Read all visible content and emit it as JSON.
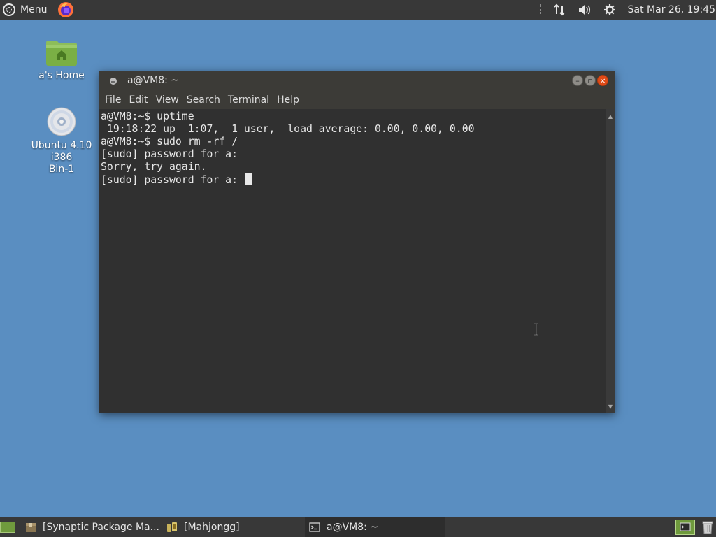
{
  "top_panel": {
    "menu_label": "Menu",
    "clock": "Sat Mar 26, 19:45"
  },
  "desktop": {
    "icons": [
      {
        "label": "a's Home"
      },
      {
        "label_line1": "Ubuntu 4.10 i386",
        "label_line2": "Bin-1"
      }
    ]
  },
  "terminal": {
    "title": "a@VM8: ~",
    "menu": [
      "File",
      "Edit",
      "View",
      "Search",
      "Terminal",
      "Help"
    ],
    "lines": [
      "a@VM8:~$ uptime",
      " 19:18:22 up  1:07,  1 user,  load average: 0.00, 0.00, 0.00",
      "a@VM8:~$ sudo rm -rf /",
      "[sudo] password for a:",
      "Sorry, try again.",
      "[sudo] password for a: "
    ]
  },
  "taskbar": {
    "items": [
      {
        "label": "[Synaptic Package Ma..."
      },
      {
        "label": "[Mahjongg]"
      },
      {
        "label": "a@VM8: ~"
      }
    ]
  },
  "colors": {
    "desktop_bg": "#5a8ec1",
    "panel_bg": "#383838",
    "terminal_bg": "#303030",
    "close_button": "#df4a16"
  }
}
